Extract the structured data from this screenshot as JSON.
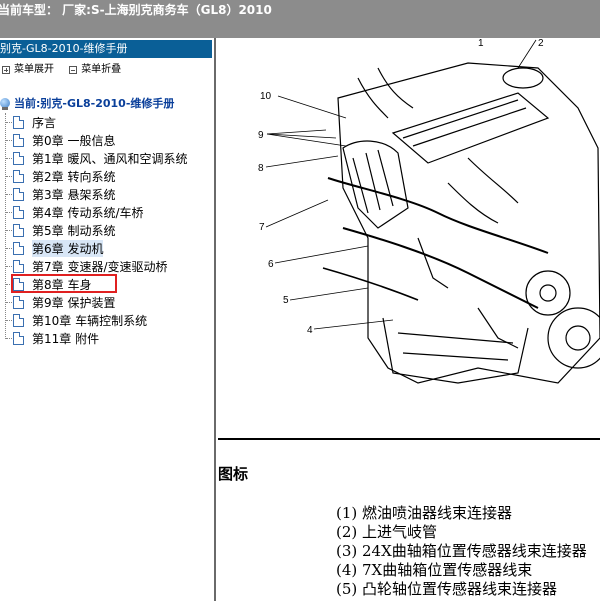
{
  "header": {
    "title": "当前车型： 厂家:S-上海别克商务车（GL8）2010"
  },
  "sidebar": {
    "header": "别克-GL8-2010-维修手册",
    "expand_label": "菜单展开",
    "collapse_label": "菜单折叠",
    "root_label": "当前:别克-GL8-2010-维修手册",
    "items": [
      {
        "label": "序言"
      },
      {
        "label": "第0章 一般信息"
      },
      {
        "label": "第1章 暖风、通风和空调系统"
      },
      {
        "label": "第2章 转向系统"
      },
      {
        "label": "第3章 悬架系统"
      },
      {
        "label": "第4章 传动系统/车桥"
      },
      {
        "label": "第5章 制动系统"
      },
      {
        "label": "第6章 发动机"
      },
      {
        "label": "第7章 变速器/变速驱动桥"
      },
      {
        "label": "第8章 车身"
      },
      {
        "label": "第9章 保护装置"
      },
      {
        "label": "第10章 车辆控制系统"
      },
      {
        "label": "第11章 附件"
      }
    ],
    "selected_index": 7
  },
  "figure": {
    "callouts": [
      "1",
      "2",
      "4",
      "5",
      "6",
      "7",
      "8",
      "9",
      "10"
    ]
  },
  "legend": {
    "title": "图标",
    "items": [
      "(1) 燃油喷油器线束连接器",
      "(2) 上进气岐管",
      "(3) 24X曲轴箱位置传感器线束连接器",
      "(4) 7X曲轴箱位置传感器线束",
      "(5) 凸轮轴位置传感器线束连接器"
    ]
  },
  "colors": {
    "topbar": "#8c8c8c",
    "sidebar_header": "#0a5f97",
    "root_label": "#0a3f9a",
    "highlight": "#e02020"
  }
}
